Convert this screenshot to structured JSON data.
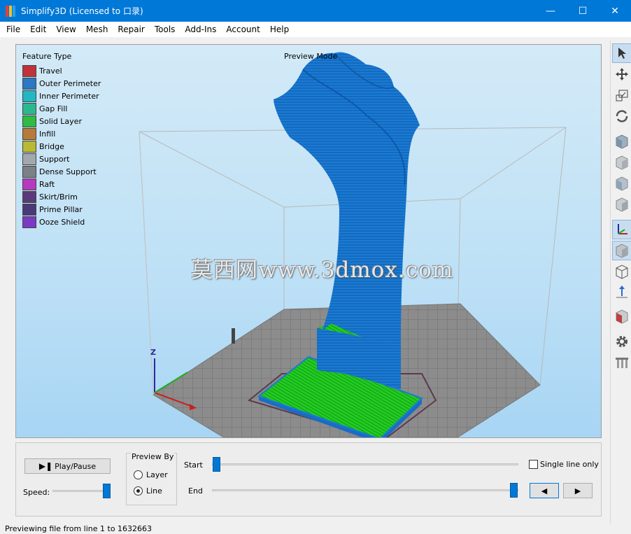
{
  "window": {
    "title": "Simplify3D (Licensed to 口录)",
    "minimize": "—",
    "maximize": "☐",
    "close": "✕"
  },
  "menu": [
    "File",
    "Edit",
    "View",
    "Mesh",
    "Repair",
    "Tools",
    "Add-Ins",
    "Account",
    "Help"
  ],
  "viewport": {
    "legend_title": "Feature Type",
    "preview_mode": "Preview Mode",
    "watermark": "莫西网www.3dmox.com",
    "axis_label": "Z",
    "legend": [
      {
        "label": "Travel",
        "color": "#c0323b"
      },
      {
        "label": "Outer Perimeter",
        "color": "#2a78c4"
      },
      {
        "label": "Inner Perimeter",
        "color": "#22b7c4"
      },
      {
        "label": "Gap Fill",
        "color": "#2cb88e"
      },
      {
        "label": "Solid Layer",
        "color": "#2ebc44"
      },
      {
        "label": "Infill",
        "color": "#b87a3a"
      },
      {
        "label": "Bridge",
        "color": "#b9b934"
      },
      {
        "label": "Support",
        "color": "#a3a8ad"
      },
      {
        "label": "Dense Support",
        "color": "#7c8087"
      },
      {
        "label": "Raft",
        "color": "#b53ac1"
      },
      {
        "label": "Skirt/Brim",
        "color": "#5a3a78"
      },
      {
        "label": "Prime Pillar",
        "color": "#4a3a7a"
      },
      {
        "label": "Ooze Shield",
        "color": "#7a3ac4"
      }
    ]
  },
  "controls": {
    "play_pause": "Play/Pause",
    "speed_label": "Speed:",
    "preview_by_title": "Preview By",
    "preview_options": [
      {
        "label": "Layer",
        "checked": false
      },
      {
        "label": "Line",
        "checked": true
      }
    ],
    "start_label": "Start",
    "end_label": "End",
    "single_line_only": "Single line only",
    "prev_icon": "◀",
    "next_icon": "▶"
  },
  "status": "Previewing file from line 1 to 1632663",
  "colors": {
    "titlebar": "#0078d7",
    "accent": "#0078d7",
    "model_blue": "#1a7bd4",
    "model_green": "#22cc22"
  }
}
